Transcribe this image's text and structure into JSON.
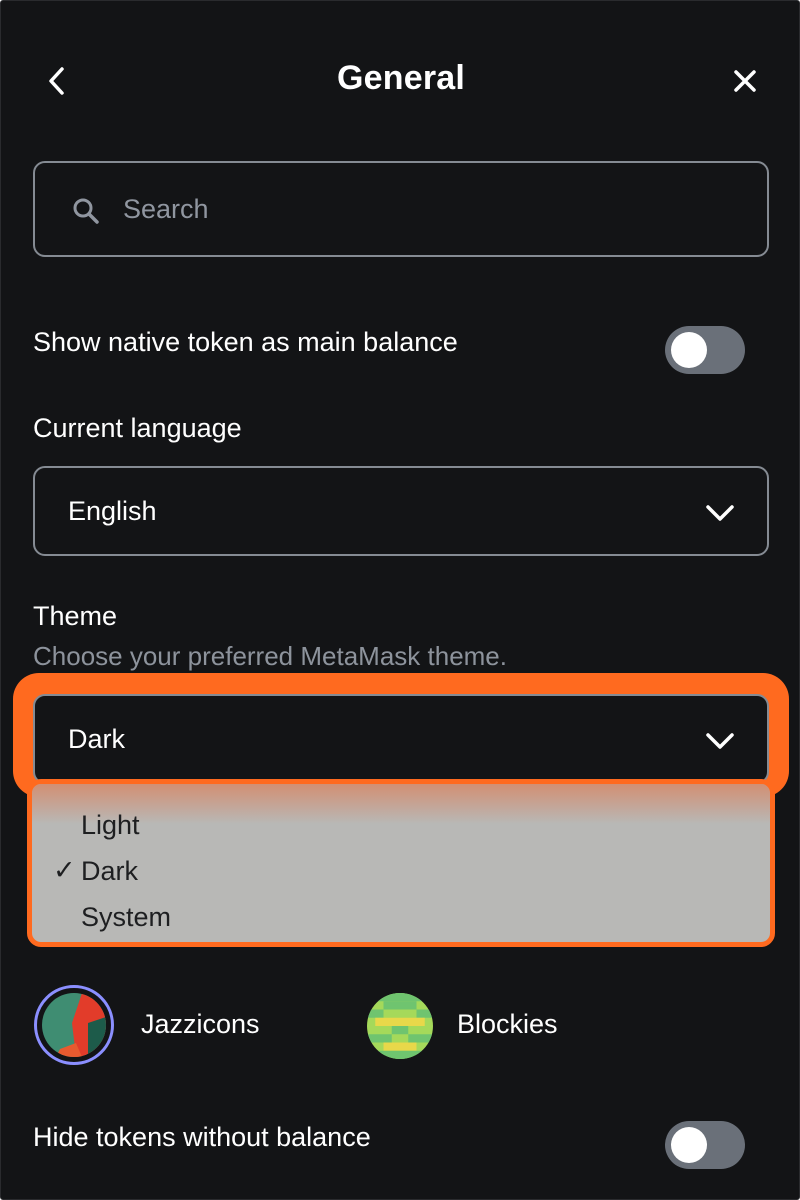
{
  "header": {
    "title": "General"
  },
  "search": {
    "placeholder": "Search"
  },
  "settings": {
    "native_token": {
      "label": "Show native token as main balance",
      "enabled": false
    },
    "language": {
      "label": "Current language",
      "value": "English"
    },
    "theme": {
      "label": "Theme",
      "description": "Choose your preferred MetaMask theme.",
      "value": "Dark",
      "options": [
        {
          "label": "Light",
          "selected": false
        },
        {
          "label": "Dark",
          "selected": true
        },
        {
          "label": "System",
          "selected": false
        }
      ]
    },
    "account_identicon": {
      "options": [
        {
          "label": "Jazzicons",
          "selected": true
        },
        {
          "label": "Blockies",
          "selected": false
        }
      ]
    },
    "hide_tokens": {
      "label": "Hide tokens without balance",
      "enabled": false
    }
  },
  "icons": {
    "back": "chevron-left-icon",
    "close": "close-icon",
    "search": "search-icon",
    "dropdown": "chevron-down-icon",
    "check": "✓"
  },
  "colors": {
    "background": "#131416",
    "border": "#858b93",
    "highlight": "#ff6a1f",
    "toggle_off": "#6a7079",
    "dropdown_bg": "#b8b8b6",
    "muted_text": "#8d939c",
    "selected_ring": "#8b8fff"
  }
}
